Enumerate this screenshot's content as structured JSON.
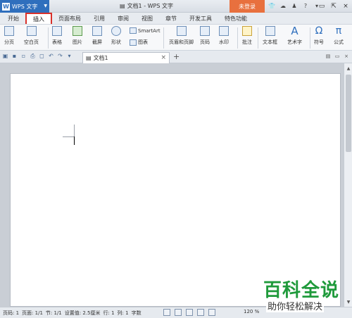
{
  "app_menu": {
    "label": "WPS 文字"
  },
  "window_title": "文档1 - WPS 文字",
  "login": "未登录",
  "window_controls": [
    "_",
    "□",
    "×"
  ],
  "tabs": [
    {
      "label": "开始"
    },
    {
      "label": "插入",
      "active": true
    },
    {
      "label": "页面布局"
    },
    {
      "label": "引用"
    },
    {
      "label": "审阅"
    },
    {
      "label": "视图"
    },
    {
      "label": "章节"
    },
    {
      "label": "开发工具"
    },
    {
      "label": "特色功能"
    }
  ],
  "ribbon": {
    "page_break": "分页",
    "blank_page": "空白页",
    "table": "表格",
    "picture": "图片",
    "screenshot": "截屏",
    "shape": "形状",
    "smartart": "SmartArt",
    "chart": "图表",
    "header_footer": "页眉和页脚",
    "page_number": "页码",
    "watermark": "水印",
    "comment": "批注",
    "text_box": "文本框",
    "word_art": "艺术字",
    "symbol": "符号",
    "formula": "公式"
  },
  "doc_tab": {
    "label": "文档1"
  },
  "status": {
    "page_num": "页码: 1",
    "pages": "页面: 1/1",
    "section": "节: 1/1",
    "setting": "设置值: 2.5厘米",
    "row": "行: 1",
    "column": "列: 1",
    "words": "字数",
    "zoom": "120 %"
  },
  "watermark_brand": {
    "line1": "百科全说",
    "line2": "助你轻松解决"
  }
}
